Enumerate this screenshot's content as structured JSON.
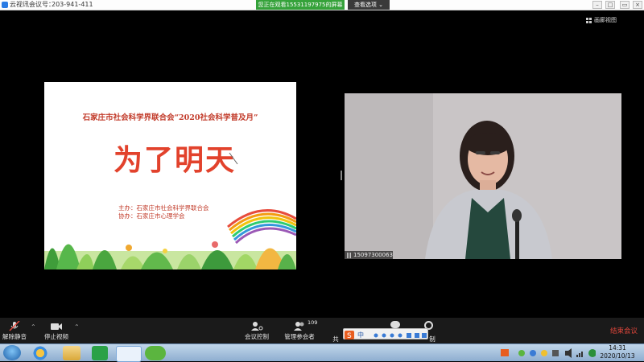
{
  "titlebar": {
    "app_name": "云视讯",
    "meeting_id_label": "会议号：",
    "meeting_id": "203-941-411",
    "viewing_banner": "您正在观看15531197975的屏幕",
    "view_options": "查看选项"
  },
  "layout_button": "画廊视图",
  "slide": {
    "header": "石家庄市社会科学界联合会“2020社会科学普及月”",
    "main_title": "为了明天",
    "host_line": "主办：石家庄市社会科学界联合会",
    "co_host_line": "协办：石家庄市心理学会"
  },
  "participant": {
    "name": "15097300063"
  },
  "toolbar": {
    "unmute": "解除静音",
    "stop_video": "停止视频",
    "meeting_control": "会议控制",
    "manage_participants": "管理参会者",
    "participant_count": "109",
    "share_partial": "共",
    "record_partial": "制",
    "end_meeting": "结束会议"
  },
  "ime": {
    "lang": "中"
  },
  "clock": {
    "time": "14:31",
    "date": "2020/10/13"
  },
  "colors": {
    "banner_green": "#35a23a",
    "end_red": "#e0463b",
    "slide_red": "#e2422c"
  }
}
